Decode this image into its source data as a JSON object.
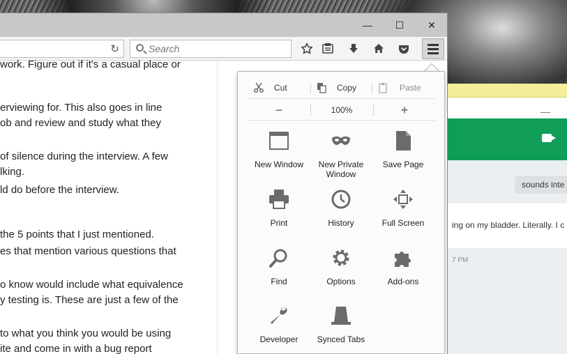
{
  "browser": {
    "search_placeholder": "Search",
    "toolbar_icons": [
      "reload-icon",
      "star-icon",
      "reading-list-icon",
      "download-icon",
      "home-icon",
      "pocket-icon",
      "hamburger-menu-icon"
    ],
    "window_controls": {
      "minimize": "—",
      "maximize": "☐",
      "close": "✕"
    }
  },
  "page": {
    "lines": [
      "work. Figure out if it's a casual place or",
      "erviewing for. This also goes in line",
      "ob and review and study what they",
      "of silence during the interview. A few",
      "lking.",
      "ld do before the interview.",
      "the 5 points that I just mentioned.",
      "es that mention various questions that",
      "o know would include what equivalence",
      "y testing is. These are just a few of the",
      "to what you think you would be using",
      "ite and come in with a bug report"
    ]
  },
  "menu": {
    "edit": {
      "cut": "Cut",
      "copy": "Copy",
      "paste": "Paste"
    },
    "zoom": {
      "minus": "−",
      "level": "100%",
      "plus": "+"
    },
    "items": [
      {
        "label": "New Window",
        "icon": "new-window-icon"
      },
      {
        "label": "New Private Window",
        "icon": "private-mask-icon"
      },
      {
        "label": "Save Page",
        "icon": "save-page-icon"
      },
      {
        "label": "Print",
        "icon": "printer-icon"
      },
      {
        "label": "History",
        "icon": "clock-icon"
      },
      {
        "label": "Full Screen",
        "icon": "full-screen-icon"
      },
      {
        "label": "Find",
        "icon": "magnifier-icon"
      },
      {
        "label": "Options",
        "icon": "gear-icon"
      },
      {
        "label": "Add-ons",
        "icon": "puzzle-icon"
      },
      {
        "label": "Developer",
        "icon": "wrench-icon"
      },
      {
        "label": "Synced Tabs",
        "icon": "synced-tabs-icon"
      }
    ]
  },
  "chat": {
    "bubble_right": "sounds inte",
    "bubble_left": "ing on my bladder. Literally. I c",
    "time": "7 PM"
  },
  "colors": {
    "chat_header": "#0f9d58",
    "menu_icon": "#6b6b6b"
  }
}
